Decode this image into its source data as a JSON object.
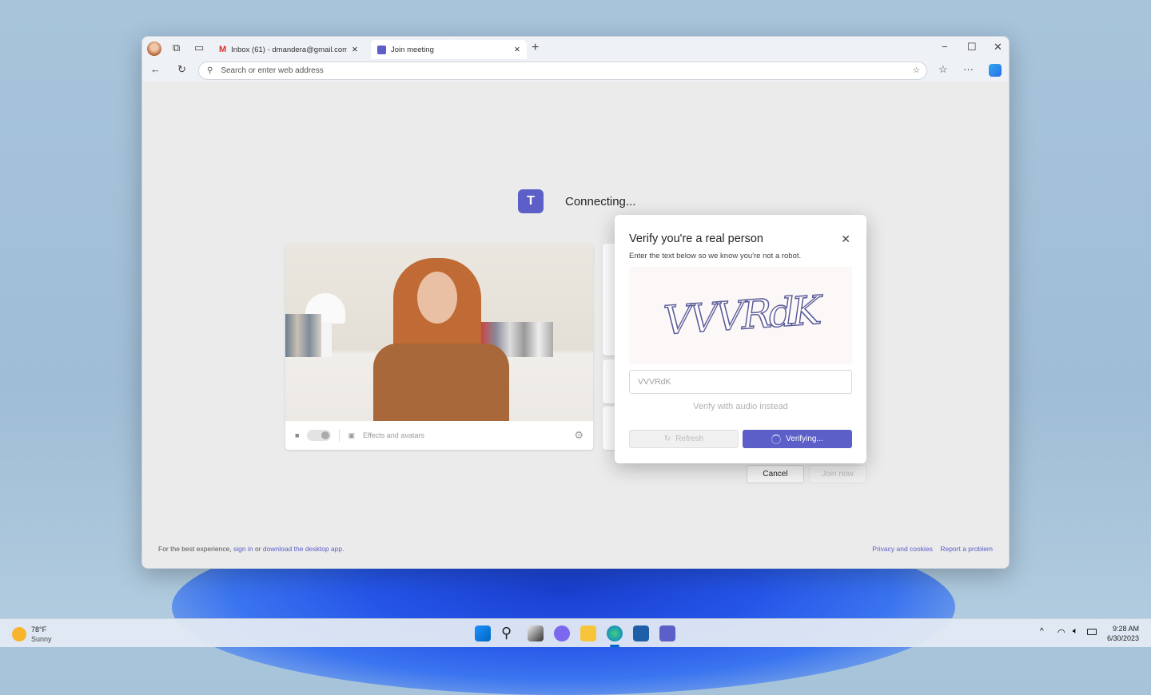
{
  "browser": {
    "tabs": [
      {
        "label": "Inbox (61) - dmandera@gmail.com",
        "icon": "gmail-icon"
      },
      {
        "label": "Join meeting",
        "icon": "teams-icon",
        "active": true
      }
    ],
    "address_placeholder": "Search or enter web address"
  },
  "page": {
    "status": "Connecting...",
    "effects_label": "Effects and avatars",
    "cancel": "Cancel",
    "join_now": "Join now",
    "footer_prefix": "For the best experience, ",
    "footer_sign_in": "sign in",
    "footer_or": " or ",
    "footer_download": "download the desktop app.",
    "privacy": "Privacy and cookies",
    "report": "Report a problem"
  },
  "dialog": {
    "title": "Verify you're a real person",
    "subtitle": "Enter the text below so we know you're not a robot.",
    "captcha_text": "VVVRdK",
    "input_value": "VVVRdK",
    "audio_link": "Verify with audio instead",
    "refresh": "Refresh",
    "verifying": "Verifying...",
    "accent": "#5b5fc7"
  },
  "taskbar": {
    "temp": "78°F",
    "weather": "Sunny",
    "time": "9:28 AM",
    "date": "6/30/2023"
  }
}
